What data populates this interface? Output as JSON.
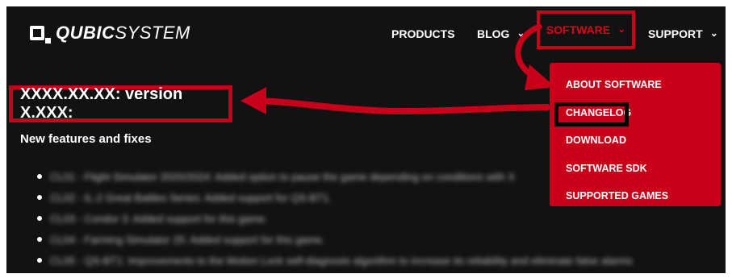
{
  "header": {
    "logo_bold": "QUBIC",
    "logo_rest": "SYSTEM"
  },
  "nav": {
    "products": "PRODUCTS",
    "blog": "BLOG",
    "software": "SOFTWARE",
    "support": "SUPPORT",
    "chevron": "⌄"
  },
  "dropdown": {
    "items": [
      {
        "label": "ABOUT SOFTWARE"
      },
      {
        "label": "CHANGELOG"
      },
      {
        "label": "DOWNLOAD"
      },
      {
        "label": "SOFTWARE SDK"
      },
      {
        "label": "SUPPORTED GAMES"
      }
    ]
  },
  "main": {
    "version_heading": "XXXX.XX.XX: version X.XXX:",
    "section_title": "New features and fixes",
    "list": [
      "CL01 - Flight Simulator 2020/2024: Added option to pause the game depending on conditions with X",
      "CL02 - IL-2 Great Battles Series: Added support for QS-BT1.",
      "CL03 - Condor 3: Added support for this game.",
      "CL04 - Farming Simulator 25: Added support for this game.",
      "CL05 - QS-BT1: Improvements to the Motion Lock self-diagnosis algorithm to increase its reliability and eliminate false alarms"
    ]
  },
  "colors": {
    "background": "#121212",
    "accent": "#c8001a",
    "text": "#ffffff"
  }
}
